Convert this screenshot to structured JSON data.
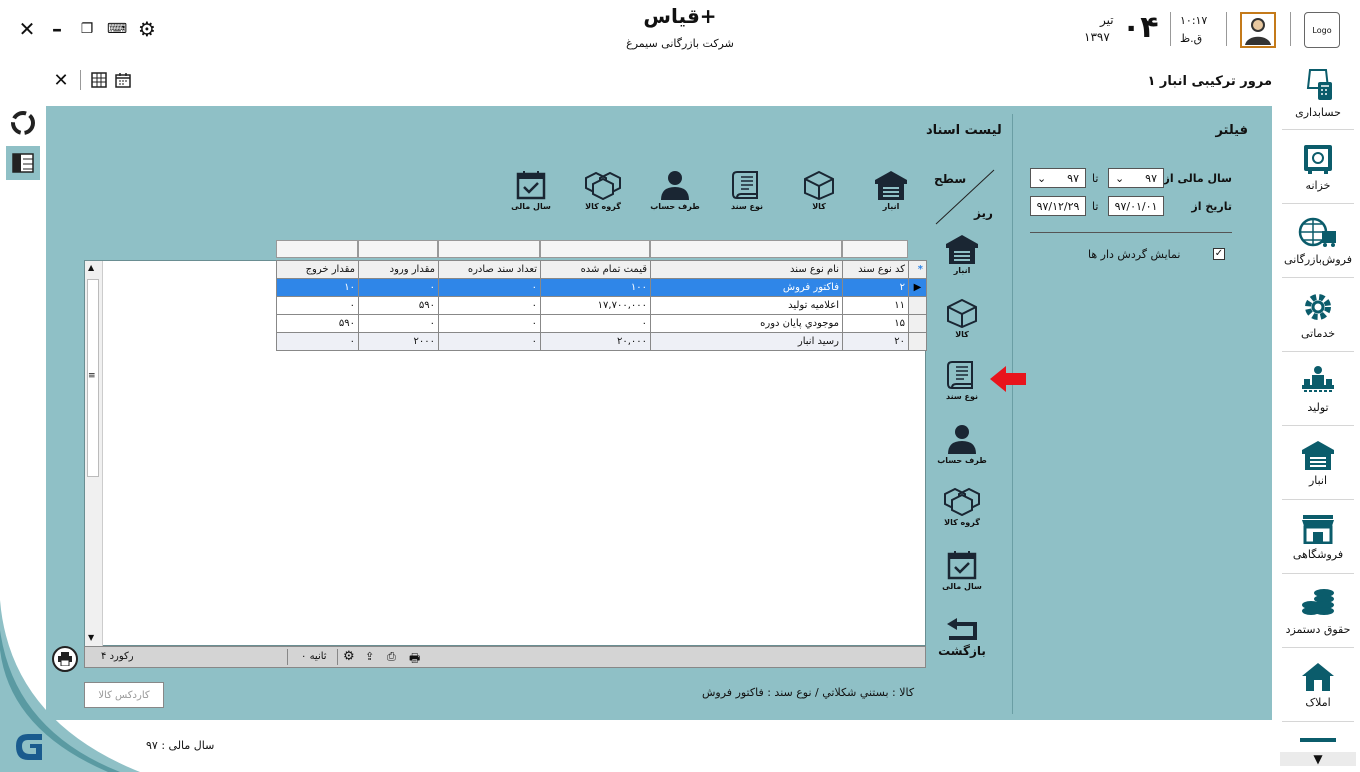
{
  "header": {
    "app_title": "قیاس+",
    "company": "شرکت بازرگانی سیمرغ",
    "time": "۱۰:۱۷",
    "period": "ق.ظ",
    "day": "۰۴",
    "month": "تیر",
    "year": "۱۳۹۷",
    "logo": "Logo"
  },
  "toolbar": {
    "page_title": "مرور ترکیبی انبار ۱"
  },
  "filter": {
    "title": "فیلتر",
    "fiscal_year_label": "سال مالی از",
    "fiscal_from": "۹۷",
    "to_label": "تا",
    "fiscal_to": "۹۷",
    "date_label": "تاریخ از",
    "date_from": "۹۷/۰۱/۰۱",
    "date_to": "۹۷/۱۲/۲۹",
    "show_turnover_label": "نمایش گردش دار ها",
    "show_turnover_checked": true
  },
  "doc_list_title": "لیست اسناد",
  "level_label": "سطح",
  "detail_label": "ریز",
  "top_tools": [
    {
      "label": "انبار",
      "icon": "warehouse-icon"
    },
    {
      "label": "کالا",
      "icon": "box-icon"
    },
    {
      "label": "نوع سند",
      "icon": "document-icon"
    },
    {
      "label": "طرف حساب",
      "icon": "person-icon"
    },
    {
      "label": "گروه کالا",
      "icon": "boxes-icon"
    },
    {
      "label": "سال مالی",
      "icon": "calendar-check-icon"
    }
  ],
  "side_tools": [
    {
      "label": "انبار",
      "icon": "warehouse-icon"
    },
    {
      "label": "کالا",
      "icon": "box-icon"
    },
    {
      "label": "نوع سند",
      "icon": "document-icon"
    },
    {
      "label": "طرف حساب",
      "icon": "person-icon"
    },
    {
      "label": "گروه کالا",
      "icon": "boxes-icon"
    },
    {
      "label": "سال مالی",
      "icon": "calendar-check-icon"
    }
  ],
  "back_label": "بازگشت",
  "grid": {
    "columns": [
      "کد نوع سند",
      "نام نوع سند",
      "قیمت تمام شده",
      "تعداد سند صادره",
      "مقدار ورود",
      "مقدار خروج"
    ],
    "rows": [
      [
        "۲",
        "فاکتور فروش",
        "۱۰۰",
        "۰",
        "۰",
        "۱۰"
      ],
      [
        "۱۱",
        "اعلامیه تولید",
        "۱۷,۷۰۰,۰۰۰",
        "۰",
        "۵۹۰",
        "۰"
      ],
      [
        "۱۵",
        "موجودي پایان دوره",
        "۰",
        "۰",
        "۰",
        "۵۹۰"
      ],
      [
        "۲۰",
        "رسید انبار",
        "۲۰,۰۰۰",
        "۰",
        "۲۰۰۰",
        "۰"
      ]
    ],
    "record_count": "۴ رکورد",
    "seconds": "۰ ثانیه"
  },
  "status_text": "کالا : بستني شکلاتي /  نوع سند : فاکتور فروش",
  "kardex_button": "کاردکس کالا",
  "fiscal_year_status": "سال مالی : ۹۷",
  "nav": [
    {
      "label": "حسابداری",
      "icon": "accounting-icon"
    },
    {
      "label": "خزانه",
      "icon": "safe-icon"
    },
    {
      "label": "فروش‌بازرگانی",
      "icon": "globe-trade-icon"
    },
    {
      "label": "خدماتی",
      "icon": "gear-icon"
    },
    {
      "label": "تولید",
      "icon": "production-icon"
    },
    {
      "label": "انبار",
      "icon": "warehouse-icon"
    },
    {
      "label": "فروشگاهی",
      "icon": "store-icon"
    },
    {
      "label": "حقوق دستمزد",
      "icon": "coins-icon"
    },
    {
      "label": "املاک",
      "icon": "house-icon"
    }
  ],
  "colors": {
    "panel": "#8fc0c6",
    "selected_row": "#2f86e8",
    "arrow": "#e8141c"
  }
}
